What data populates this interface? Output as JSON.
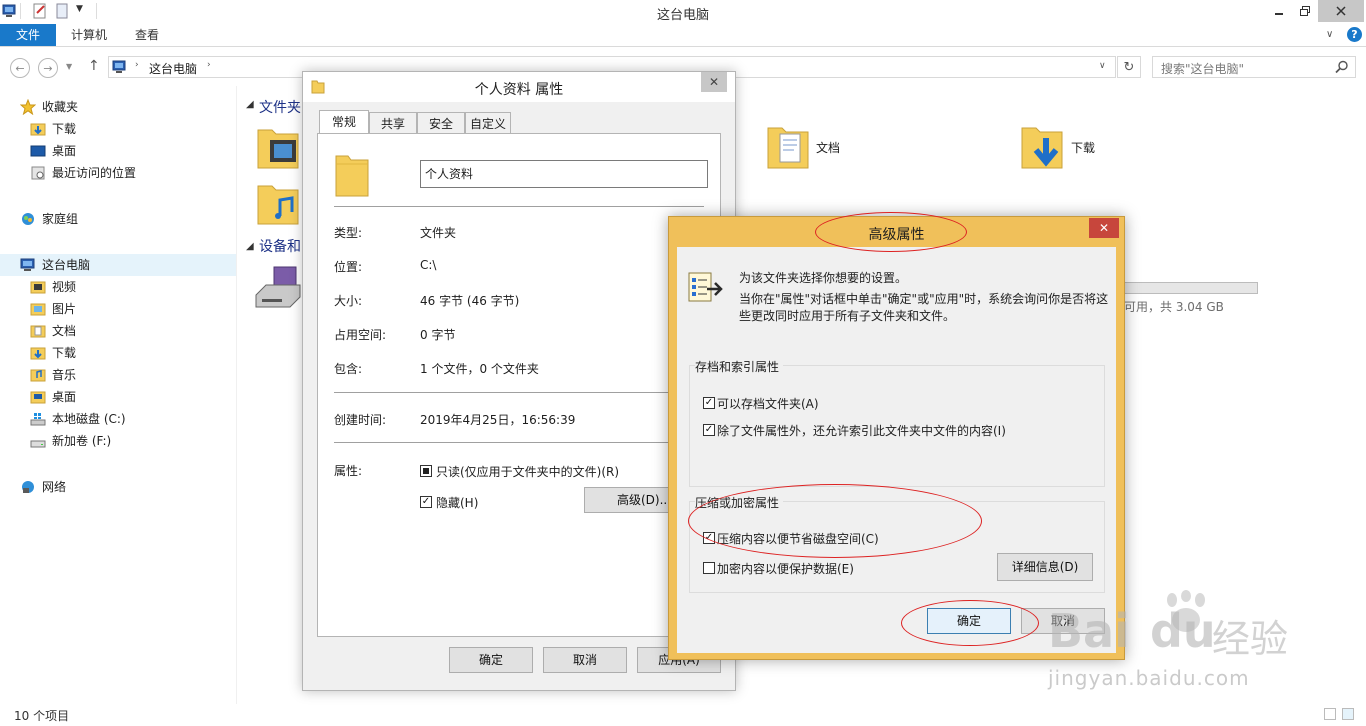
{
  "window": {
    "title": "这台电脑"
  },
  "ribbon": {
    "tabs": [
      "文件",
      "计算机",
      "查看"
    ]
  },
  "address": {
    "path": "这台电脑",
    "search_placeholder": "搜索\"这台电脑\""
  },
  "nav": {
    "favorites": {
      "label": "收藏夹",
      "items": [
        "下载",
        "桌面",
        "最近访问的位置"
      ]
    },
    "homegroup": "家庭组",
    "thispc": {
      "label": "这台电脑",
      "items": [
        "视频",
        "图片",
        "文档",
        "下载",
        "音乐",
        "桌面",
        "本地磁盘 (C:)",
        "新加卷 (F:)"
      ]
    },
    "network": "网络"
  },
  "content": {
    "section_folders": "文件夹",
    "section_devices": "设备和",
    "folder_docs": "文档",
    "folder_downloads": "下载",
    "drive_tail": "可用，共 3.04 GB"
  },
  "status": {
    "count": "10 个项目"
  },
  "props_dialog": {
    "title": "个人资料 属性",
    "tabs": [
      "常规",
      "共享",
      "安全",
      "自定义"
    ],
    "name_value": "个人资料",
    "rows": [
      {
        "label": "类型:",
        "value": "文件夹"
      },
      {
        "label": "位置:",
        "value": "C:\\"
      },
      {
        "label": "大小:",
        "value": "46 字节 (46 字节)"
      },
      {
        "label": "占用空间:",
        "value": "0 字节"
      },
      {
        "label": "包含:",
        "value": "1 个文件，0 个文件夹"
      }
    ],
    "created_label": "创建时间:",
    "created_value": "2019年4月25日，16:56:39",
    "attrs_label": "属性:",
    "readonly_label": "只读(仅应用于文件夹中的文件)(R)",
    "hidden_label": "隐藏(H)",
    "advanced_button": "高级(D)...",
    "ok": "确定",
    "cancel": "取消",
    "apply": "应用(A)"
  },
  "adv_dialog": {
    "title": "高级属性",
    "intro1": "为该文件夹选择你想要的设置。",
    "intro2": "当你在\"属性\"对话框中单击\"确定\"或\"应用\"时，系统会询问你是否将这些更改同时应用于所有子文件夹和文件。",
    "group1_title": "存档和索引属性",
    "archive_label": "可以存档文件夹(A)",
    "index_label": "除了文件属性外，还允许索引此文件夹中文件的内容(I)",
    "group2_title": "压缩或加密属性",
    "compress_label": "压缩内容以便节省磁盘空间(C)",
    "encrypt_label": "加密内容以便保护数据(E)",
    "details_button": "详细信息(D)",
    "ok": "确定",
    "cancel": "取消"
  },
  "watermark": {
    "brand": "Bai",
    "brand2": "du",
    "cn": "经验",
    "url": "jingyan.baidu.com"
  },
  "colors": {
    "accent": "#1979ca",
    "dialog_frame": "#f0c05a",
    "highlight": "#dd2222"
  }
}
